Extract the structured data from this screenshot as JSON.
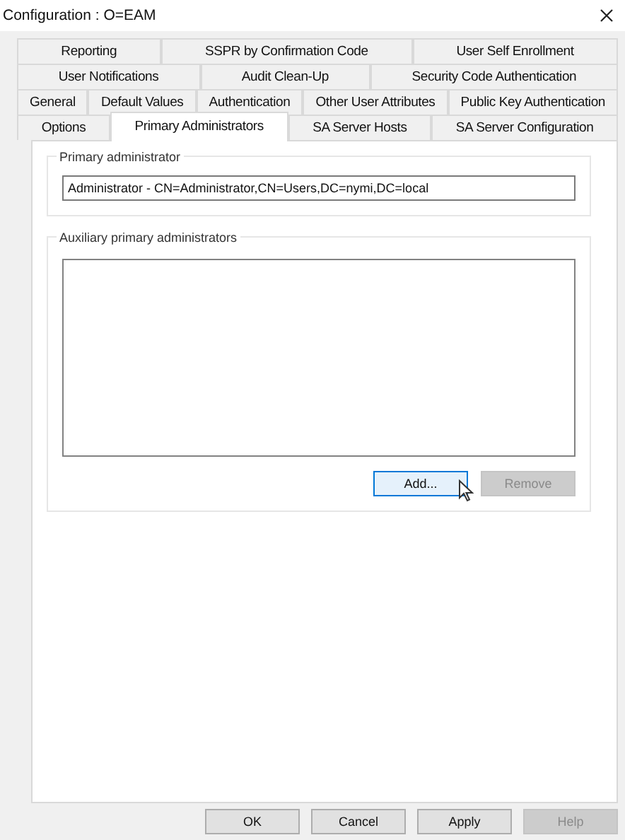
{
  "window": {
    "title": "Configuration : O=EAM"
  },
  "tab_rows": [
    [
      {
        "label": "Reporting",
        "selected": false
      },
      {
        "label": "SSPR by Confirmation Code",
        "selected": false
      },
      {
        "label": "User Self Enrollment",
        "selected": false
      }
    ],
    [
      {
        "label": "User Notifications",
        "selected": false
      },
      {
        "label": "Audit Clean-Up",
        "selected": false
      },
      {
        "label": "Security Code Authentication",
        "selected": false
      }
    ],
    [
      {
        "label": "General",
        "selected": false
      },
      {
        "label": "Default Values",
        "selected": false
      },
      {
        "label": "Authentication",
        "selected": false
      },
      {
        "label": "Other User Attributes",
        "selected": false
      },
      {
        "label": "Public Key Authentication",
        "selected": false
      }
    ],
    [
      {
        "label": "Options",
        "selected": false
      },
      {
        "label": "Primary Administrators",
        "selected": true
      },
      {
        "label": "SA Server Hosts",
        "selected": false
      },
      {
        "label": "SA Server Configuration",
        "selected": false
      }
    ]
  ],
  "primary_group": {
    "title": "Primary administrator",
    "value": "Administrator - CN=Administrator,CN=Users,DC=nymi,DC=local"
  },
  "auxiliary_group": {
    "title": "Auxiliary primary administrators",
    "buttons": [
      {
        "label": "Add...",
        "disabled": false
      },
      {
        "label": "Remove",
        "disabled": true
      }
    ]
  },
  "dialog_buttons": [
    {
      "label": "OK",
      "disabled": false
    },
    {
      "label": "Cancel",
      "disabled": false
    },
    {
      "label": "Apply",
      "disabled": false
    },
    {
      "label": "Help",
      "disabled": true
    }
  ]
}
